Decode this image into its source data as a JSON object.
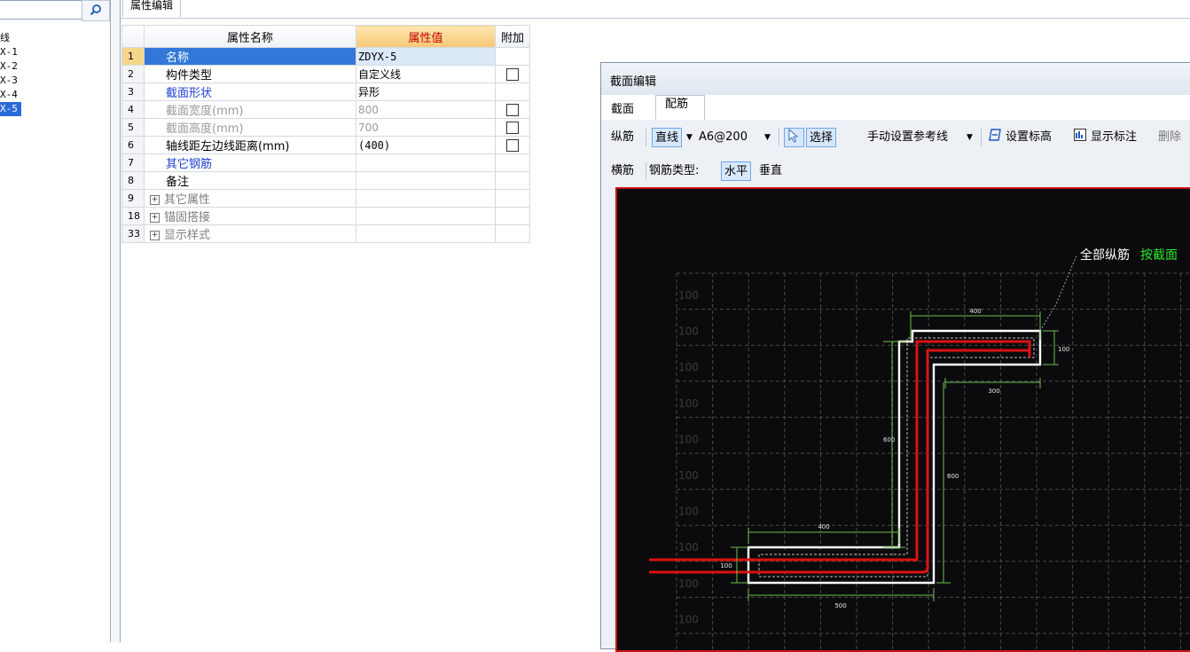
{
  "left_panel": {
    "search_placeholder": "",
    "tree_items": [
      "线",
      "X-1",
      "X-2",
      "X-3",
      "X-4",
      "X-5"
    ],
    "selected_index": 5
  },
  "tab": {
    "title": "属性编辑"
  },
  "grid": {
    "headers": {
      "name": "属性名称",
      "value": "属性值",
      "extra": "附加"
    },
    "rows": [
      {
        "num": "1",
        "name": "名称",
        "value": "ZDYX-5",
        "checkbox": false
      },
      {
        "num": "2",
        "name": "构件类型",
        "value": "自定义线",
        "checkbox": true
      },
      {
        "num": "3",
        "name": "截面形状",
        "value": "异形",
        "checkbox": false
      },
      {
        "num": "4",
        "name": "截面宽度(mm)",
        "value": "800",
        "checkbox": true
      },
      {
        "num": "5",
        "name": "截面高度(mm)",
        "value": "700",
        "checkbox": true
      },
      {
        "num": "6",
        "name": "轴线距左边线距离(mm)",
        "value": "(400)",
        "checkbox": true
      },
      {
        "num": "7",
        "name": "其它钢筋",
        "value": "",
        "checkbox": false
      },
      {
        "num": "8",
        "name": "备注",
        "value": "",
        "checkbox": false
      },
      {
        "num": "9",
        "name": "其它属性",
        "value": "",
        "checkbox": false
      },
      {
        "num": "18",
        "name": "锚固搭接",
        "value": "",
        "checkbox": false
      },
      {
        "num": "33",
        "name": "显示样式",
        "value": "",
        "checkbox": false
      }
    ]
  },
  "section_editor": {
    "title": "截面编辑",
    "tabs": [
      "截面",
      "配筋"
    ],
    "active_tab": "配筋",
    "toolbar1": {
      "longitudinal": "纵筋",
      "mode": "直线",
      "rebar_spec": "A6@200",
      "select": "选择",
      "ref_line": "手动设置参考线",
      "set_elevation": "设置标高",
      "show_annotation": "显示标注",
      "delete": "删除"
    },
    "toolbar2": {
      "stirrup": "横筋",
      "rebar_type_label": "钢筋类型:",
      "horizontal": "水平",
      "vertical": "垂直"
    },
    "canvas": {
      "annotation_prefix": "全部纵筋",
      "annotation_green": "按截面",
      "grid_label": "100",
      "dims": {
        "top": "400",
        "right_small": "100",
        "inner_top": "300",
        "left_mid": "600",
        "right_mid": "600",
        "bottom_inner": "400",
        "left_small": "100",
        "bottom": "500"
      }
    }
  }
}
